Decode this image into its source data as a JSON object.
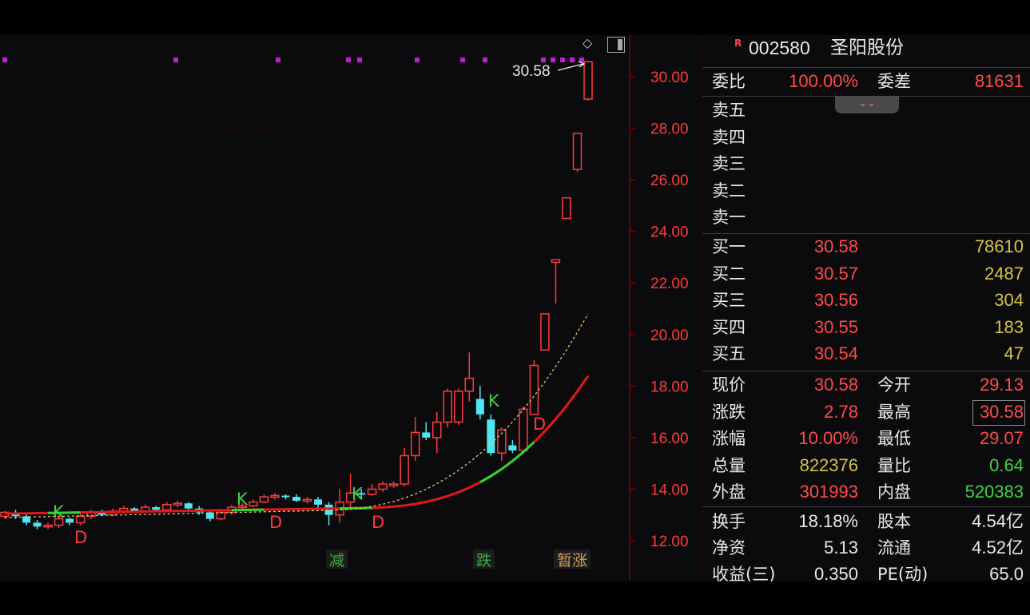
{
  "chart": {
    "price_ticks": [
      "30.00",
      "28.00",
      "26.00",
      "24.00",
      "22.00",
      "20.00",
      "18.00",
      "16.00",
      "14.00",
      "12.00"
    ],
    "last_price_tag": "30.58",
    "signal_markers": [
      {
        "text": "K",
        "price": 12.9,
        "x": 66
      },
      {
        "text": "D",
        "price": 11.9,
        "x": 93
      },
      {
        "text": "K",
        "price": 13.4,
        "x": 296
      },
      {
        "text": "D",
        "price": 12.5,
        "x": 337
      },
      {
        "text": "K",
        "price": 13.6,
        "x": 440
      },
      {
        "text": "D",
        "price": 12.5,
        "x": 465
      },
      {
        "text": "K",
        "price": 17.2,
        "x": 611
      },
      {
        "text": "D",
        "price": 16.3,
        "x": 667
      }
    ],
    "event_labels": [
      {
        "text": "减",
        "x": 412,
        "color": "#3fae3f"
      },
      {
        "text": "跌",
        "x": 596,
        "color": "#3fae3f"
      },
      {
        "text": "暂涨",
        "x": 697,
        "color": "#c8a060"
      }
    ],
    "colors": {
      "up": "#ff3a3a",
      "down": "#4fe6f2",
      "ma_red": "#e01818",
      "ma_green": "#2fd62f",
      "ma_yellow": "#e2c46c",
      "purple": "#c21dd6",
      "grid": "#6a0000"
    }
  },
  "chart_data": {
    "type": "candlestick",
    "ylim": [
      11.6,
      31.0
    ],
    "ticks": [
      30,
      28,
      26,
      24,
      22,
      20,
      18,
      16,
      14,
      12
    ],
    "candles": [
      [
        12.95,
        13.1,
        12.85,
        13.15
      ],
      [
        13.1,
        12.95,
        12.85,
        13.2
      ],
      [
        12.95,
        12.7,
        12.6,
        13.05
      ],
      [
        12.7,
        12.55,
        12.45,
        12.8
      ],
      [
        12.55,
        12.6,
        12.45,
        12.7
      ],
      [
        12.6,
        12.85,
        12.5,
        12.95
      ],
      [
        12.85,
        12.7,
        12.6,
        12.9
      ],
      [
        12.7,
        12.95,
        12.6,
        13.05
      ],
      [
        12.95,
        13.1,
        12.85,
        13.2
      ],
      [
        13.1,
        13.0,
        12.95,
        13.2
      ],
      [
        13.0,
        13.15,
        12.95,
        13.25
      ],
      [
        13.15,
        13.25,
        13.05,
        13.35
      ],
      [
        13.25,
        13.15,
        13.1,
        13.3
      ],
      [
        13.15,
        13.3,
        13.1,
        13.4
      ],
      [
        13.3,
        13.2,
        13.1,
        13.35
      ],
      [
        13.2,
        13.4,
        13.15,
        13.5
      ],
      [
        13.4,
        13.45,
        13.3,
        13.55
      ],
      [
        13.45,
        13.25,
        13.2,
        13.5
      ],
      [
        13.25,
        13.1,
        13.0,
        13.35
      ],
      [
        13.1,
        12.85,
        12.75,
        13.15
      ],
      [
        12.85,
        13.1,
        12.8,
        13.15
      ],
      [
        13.1,
        13.3,
        13.0,
        13.4
      ],
      [
        13.3,
        13.35,
        13.2,
        13.45
      ],
      [
        13.35,
        13.5,
        13.3,
        13.6
      ],
      [
        13.5,
        13.7,
        13.45,
        13.8
      ],
      [
        13.7,
        13.75,
        13.6,
        13.85
      ],
      [
        13.75,
        13.7,
        13.6,
        13.8
      ],
      [
        13.7,
        13.55,
        13.5,
        13.8
      ],
      [
        13.55,
        13.6,
        13.45,
        13.7
      ],
      [
        13.6,
        13.4,
        13.2,
        13.7
      ],
      [
        13.4,
        13.0,
        12.6,
        13.5
      ],
      [
        13.0,
        13.5,
        12.7,
        14.0
      ],
      [
        13.5,
        13.85,
        13.3,
        14.6
      ],
      [
        13.85,
        13.8,
        13.6,
        14.0
      ],
      [
        13.8,
        14.0,
        13.75,
        14.2
      ],
      [
        14.0,
        14.2,
        13.9,
        14.3
      ],
      [
        14.2,
        14.2,
        14.05,
        14.3
      ],
      [
        14.2,
        15.3,
        14.1,
        15.6
      ],
      [
        15.3,
        16.2,
        15.1,
        16.8
      ],
      [
        16.2,
        16.0,
        15.9,
        16.6
      ],
      [
        16.0,
        16.6,
        15.4,
        17.0
      ],
      [
        16.6,
        17.8,
        16.4,
        17.9
      ],
      [
        16.6,
        17.8,
        16.5,
        17.9
      ],
      [
        17.8,
        18.3,
        17.4,
        19.3
      ],
      [
        17.5,
        16.9,
        16.7,
        18.0
      ],
      [
        16.7,
        15.4,
        15.3,
        16.9
      ],
      [
        15.4,
        16.3,
        15.1,
        16.4
      ],
      [
        15.7,
        15.5,
        15.4,
        15.9
      ],
      [
        15.5,
        17.1,
        15.4,
        17.2
      ],
      [
        16.9,
        18.8,
        16.9,
        19.0
      ],
      [
        19.4,
        20.8,
        19.4,
        20.8
      ],
      [
        22.8,
        22.9,
        21.2,
        22.9
      ],
      [
        24.5,
        25.3,
        24.5,
        25.3
      ],
      [
        26.4,
        27.8,
        26.3,
        27.8
      ],
      [
        29.13,
        30.58,
        29.07,
        30.58
      ]
    ],
    "ma_fast_tail": [
      [
        13.4,
        13.3
      ],
      [
        13.55,
        13.35
      ],
      [
        13.7,
        13.4
      ],
      [
        14.0,
        13.45
      ],
      [
        15.6,
        14.3
      ],
      [
        17.0,
        15.3
      ],
      [
        18.7,
        16.4
      ],
      [
        20.3,
        17.4
      ]
    ]
  },
  "quote": {
    "code": "002580",
    "name": "圣阳股份",
    "logo_letter": "R",
    "commit_ratio_label": "委比",
    "commit_ratio": "100.00%",
    "commit_diff_label": "委差",
    "commit_diff": "81631",
    "expand_icon": "chevron-down-double",
    "sells": [
      "卖五",
      "卖四",
      "卖三",
      "卖二",
      "卖一"
    ],
    "buys": [
      {
        "label": "买一",
        "price": "30.58",
        "vol": "78610"
      },
      {
        "label": "买二",
        "price": "30.57",
        "vol": "2487"
      },
      {
        "label": "买三",
        "price": "30.56",
        "vol": "304"
      },
      {
        "label": "买四",
        "price": "30.55",
        "vol": "183"
      },
      {
        "label": "买五",
        "price": "30.54",
        "vol": "47"
      }
    ],
    "stats": [
      {
        "l1": "现价",
        "v1": "30.58",
        "c1": "r",
        "l2": "今开",
        "v2": "29.13",
        "c2": "r"
      },
      {
        "l1": "涨跌",
        "v1": "2.78",
        "c1": "r",
        "l2": "最高",
        "v2": "30.58",
        "c2": "r"
      },
      {
        "l1": "涨幅",
        "v1": "10.00%",
        "c1": "r",
        "l2": "最低",
        "v2": "29.07",
        "c2": "r"
      },
      {
        "l1": "总量",
        "v1": "822376",
        "c1": "y",
        "l2": "量比",
        "v2": "0.64",
        "c2": "g"
      },
      {
        "l1": "外盘",
        "v1": "301993",
        "c1": "r",
        "l2": "内盘",
        "v2": "520383",
        "c2": "g"
      }
    ],
    "fundamentals": [
      {
        "l1": "换手",
        "v1": "18.18%",
        "l2": "股本",
        "v2": "4.54亿"
      },
      {
        "l1": "净资",
        "v1": "5.13",
        "l2": "流通",
        "v2": "4.52亿"
      },
      {
        "l1": "收益(三)",
        "v1": "0.350",
        "l2": "PE(动)",
        "v2": "65.0"
      }
    ]
  }
}
